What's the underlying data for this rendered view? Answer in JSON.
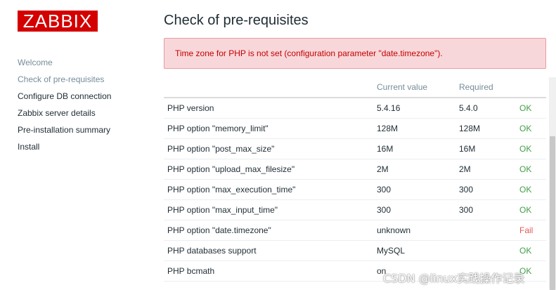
{
  "logo": {
    "text": "ZABBIX"
  },
  "sidebar": {
    "items": [
      {
        "label": "Welcome",
        "state": "done"
      },
      {
        "label": "Check of pre-requisites",
        "state": "done"
      },
      {
        "label": "Configure DB connection",
        "state": "pending"
      },
      {
        "label": "Zabbix server details",
        "state": "pending"
      },
      {
        "label": "Pre-installation summary",
        "state": "pending"
      },
      {
        "label": "Install",
        "state": "pending"
      }
    ]
  },
  "main": {
    "title": "Check of pre-requisites",
    "alert": "Time zone for PHP is not set (configuration parameter \"date.timezone\").",
    "table": {
      "headers": [
        "",
        "Current value",
        "Required",
        ""
      ],
      "rows": [
        {
          "name": "PHP version",
          "current": "5.4.16",
          "required": "5.4.0",
          "result": "OK"
        },
        {
          "name": "PHP option \"memory_limit\"",
          "current": "128M",
          "required": "128M",
          "result": "OK"
        },
        {
          "name": "PHP option \"post_max_size\"",
          "current": "16M",
          "required": "16M",
          "result": "OK"
        },
        {
          "name": "PHP option \"upload_max_filesize\"",
          "current": "2M",
          "required": "2M",
          "result": "OK"
        },
        {
          "name": "PHP option \"max_execution_time\"",
          "current": "300",
          "required": "300",
          "result": "OK"
        },
        {
          "name": "PHP option \"max_input_time\"",
          "current": "300",
          "required": "300",
          "result": "OK"
        },
        {
          "name": "PHP option \"date.timezone\"",
          "current": "unknown",
          "required": "",
          "result": "Fail"
        },
        {
          "name": "PHP databases support",
          "current": "MySQL",
          "required": "",
          "result": "OK"
        },
        {
          "name": "PHP bcmath",
          "current": "on",
          "required": "",
          "result": "OK"
        }
      ]
    }
  },
  "watermark": "CSDN @linux实践操作记录",
  "colors": {
    "brand": "#d40000",
    "ok": "#429e47",
    "fail": "#e45959",
    "alert_bg": "#f8d7da"
  }
}
